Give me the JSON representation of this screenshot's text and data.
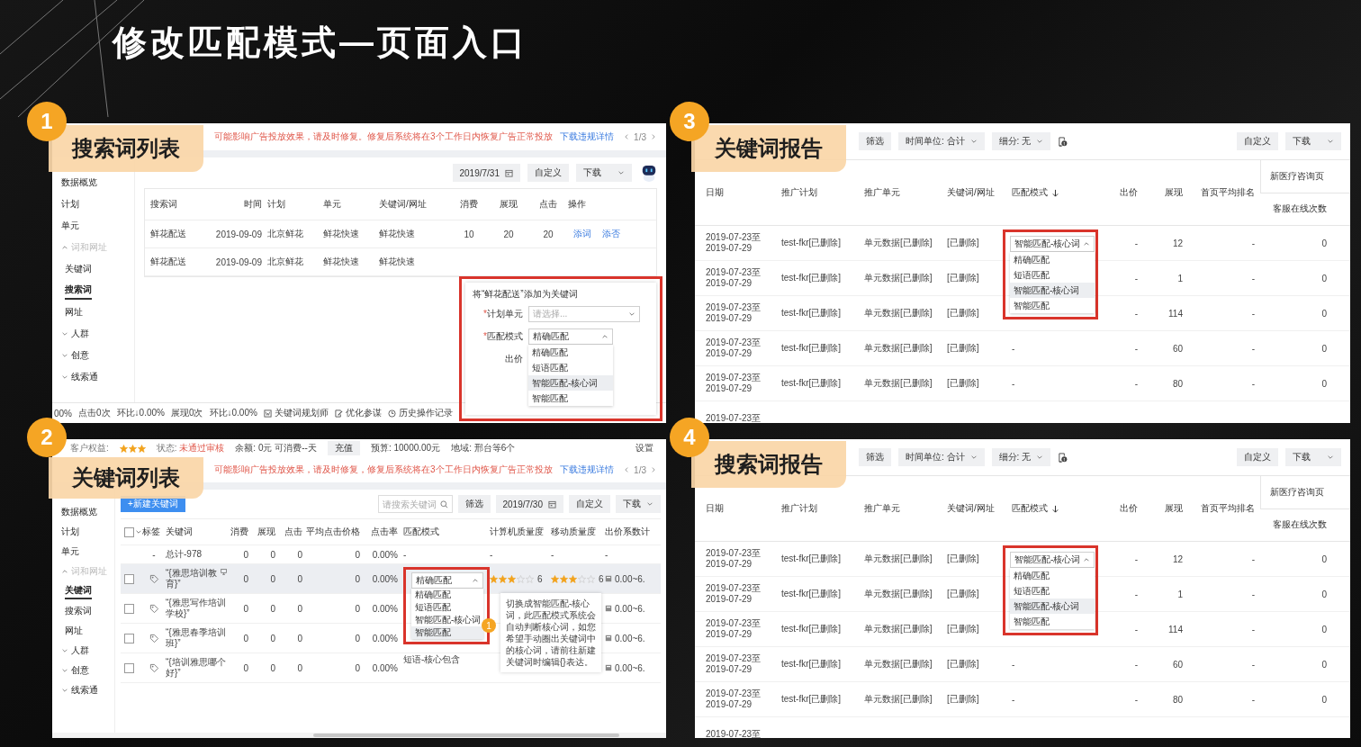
{
  "title": "修改匹配模式—页面入口",
  "panels": [
    {
      "kind": "search_term_list",
      "number": "1",
      "label": "搜索词列表",
      "notice": {
        "text": "可能影响广告投放效果，请及时修复。修复后系统将在3个工作日内恢复广告正常投放",
        "link": "下载违规详情",
        "pager": "1/3"
      },
      "sidebar": [
        {
          "label": "数据概览",
          "selected": false
        },
        {
          "label": "计划",
          "selected": false
        },
        {
          "label": "单元",
          "selected": false
        },
        {
          "label": "词和网址",
          "selected": false,
          "expanded": true,
          "children": [
            {
              "label": "关键词",
              "selected": false
            },
            {
              "label": "搜索词",
              "selected": true
            },
            {
              "label": "网址",
              "selected": false
            }
          ]
        },
        {
          "label": "人群",
          "selected": false,
          "expanded": false
        },
        {
          "label": "创意",
          "selected": false,
          "expanded": false
        },
        {
          "label": "线索通",
          "selected": false,
          "expanded": false
        }
      ],
      "toolbar": {
        "date": "2019/7/31",
        "customize": "自定义",
        "download": "下载"
      },
      "table": {
        "columns": [
          "搜索词",
          "时间",
          "计划",
          "单元",
          "关键词/网址",
          "消费",
          "展现",
          "点击",
          "操作"
        ],
        "rows": [
          {
            "cells": [
              "鲜花配送",
              "2019-09-09",
              "北京鲜花",
              "鲜花快速",
              "鲜花快速",
              "10",
              "20",
              "20"
            ],
            "actions": [
              "添词",
              "添否"
            ]
          },
          {
            "cells": [
              "鲜花配送",
              "2019-09-09",
              "北京鲜花",
              "鲜花快速",
              "鲜花快速"
            ],
            "actions": []
          }
        ]
      },
      "popup": {
        "title": "将“鲜花配送”添加为关键词",
        "fields": [
          {
            "label": "计划单元",
            "required_mark": "*",
            "kind": "select",
            "select": {
              "placeholder": "请选择...",
              "expanded": false
            }
          },
          {
            "label": "匹配模式",
            "required_mark": "*",
            "kind": "select",
            "select": {
              "value": "精确匹配",
              "expanded": true,
              "options": [
                {
                  "label": "精确匹配",
                  "highlighted": false
                },
                {
                  "label": "短语匹配",
                  "highlighted": false
                },
                {
                  "label": "智能匹配-核心词",
                  "highlighted": true
                },
                {
                  "label": "智能匹配",
                  "highlighted": false
                }
              ]
            }
          },
          {
            "label": "出价"
          }
        ]
      },
      "status_bar": {
        "stats": [
          "00%",
          "点击0次",
          "环比↓0.00%",
          "展现0次",
          "环比↓0.00%"
        ],
        "tools": [
          "关键词规划师",
          "优化参谋",
          "历史操作记录"
        ]
      }
    },
    {
      "kind": "keyword_list",
      "number": "2",
      "label": "关键词列表",
      "account_bar": {
        "rating_label": "客户权益:",
        "stars": 3,
        "status_label": "状态:",
        "status": "未通过审核",
        "balance": "余额: 0元 可消费--天",
        "recharge": "充值",
        "budget": "预算: 10000.00元",
        "region": "地域: 邢台等6个",
        "settings": "设置"
      },
      "notice": {
        "text": "可能影响广告投放效果，请及时修复，修复后系统将在3个工作日内恢复广告正常投放",
        "link": "下载违规详情",
        "pager": "1/3"
      },
      "sidebar": [
        {
          "label": "数据概览",
          "selected": false
        },
        {
          "label": "计划",
          "selected": false
        },
        {
          "label": "单元",
          "selected": false
        },
        {
          "label": "词和网址",
          "selected": false,
          "expanded": true,
          "children": [
            {
              "label": "关键词",
              "selected": true
            },
            {
              "label": "搜索词",
              "selected": false
            },
            {
              "label": "网址",
              "selected": false
            }
          ]
        },
        {
          "label": "人群",
          "selected": false,
          "expanded": false
        },
        {
          "label": "创意",
          "selected": false,
          "expanded": false
        },
        {
          "label": "线索通",
          "selected": false,
          "expanded": false
        }
      ],
      "toolbar": {
        "new_button": "+新建关键词",
        "search_placeholder": "请搜索关键词",
        "filter": "筛选",
        "date": "2019/7/30",
        "customize": "自定义",
        "download": "下载"
      },
      "table": {
        "all_checked": false,
        "columns": [
          "标签",
          "关键词",
          "消费",
          "展现",
          "点击",
          "平均点击价格",
          "点击率",
          "匹配模式",
          "计算机质量度",
          "移动质量度",
          "出价系数计"
        ],
        "rows": [
          {
            "kind": "total",
            "tag": "-",
            "keyword": "总计-978",
            "values": [
              "0",
              "0",
              "0",
              "0",
              "0.00%"
            ],
            "match": "-",
            "pc_quality": "-",
            "mobile_quality": "-",
            "bid_factor": "-"
          },
          {
            "kind": "keyword",
            "checked": false,
            "highlighted": true,
            "preview": true,
            "keyword": "“{雅思培训教育}”",
            "values": [
              "0",
              "0",
              "0",
              "0",
              "0.00%"
            ],
            "match_select": {
              "value": "精确匹配",
              "expanded": true,
              "options": [
                {
                  "label": "精确匹配",
                  "highlighted": false
                },
                {
                  "label": "短语匹配",
                  "highlighted": false
                },
                {
                  "label": "智能匹配-核心词",
                  "highlighted": false
                },
                {
                  "label": "智能匹配",
                  "highlighted": true
                }
              ]
            },
            "badge": "1",
            "pc_quality": {
              "stars": 3,
              "score": "6"
            },
            "mobile_quality": {
              "stars": 3,
              "score": "6"
            },
            "bid_factor": "0.00~6.",
            "tooltip": "切换成智能匹配-核心词，此匹配模式系统会自动判断核心词，如您希望手动圈出关键词中的核心词，请前往新建关键词时编辑{}表达。"
          },
          {
            "kind": "keyword",
            "checked": false,
            "highlighted": false,
            "preview": false,
            "keyword": "“{雅思写作培训学校}”",
            "values": [
              "0",
              "0",
              "0",
              "0",
              "0.00%"
            ],
            "bid_factor": "0.00~6."
          },
          {
            "kind": "keyword",
            "checked": false,
            "highlighted": false,
            "preview": false,
            "keyword": "“{雅思春季培训班}”",
            "values": [
              "0",
              "0",
              "0",
              "0",
              "0.00%"
            ],
            "bid_factor": "0.00~6."
          },
          {
            "kind": "keyword",
            "checked": false,
            "highlighted": false,
            "preview": false,
            "keyword": "“{培训雅思哪个好}”",
            "values": [
              "0",
              "0",
              "0",
              "0",
              "0.00%"
            ],
            "match": "短语-核心包含",
            "bid_factor": "0.00~6."
          }
        ]
      }
    },
    {
      "kind": "report",
      "number": "3",
      "label": "关键词报告",
      "toolbar": {
        "filter": "筛选",
        "time_unit": "时间单位: 合计",
        "breakdown": "细分: 无",
        "customize": "自定义",
        "download": "下载"
      },
      "table": {
        "columns": [
          "日期",
          "推广计划",
          "推广单元",
          "关键词/网址",
          "匹配模式",
          "出价",
          "展现",
          "首页平均排名"
        ],
        "group": {
          "label": "新医疗咨询页",
          "columns": [
            "客服在线次数"
          ]
        },
        "match_select": {
          "value": "智能匹配-核心词",
          "expanded": true,
          "options": [
            {
              "label": "精确匹配",
              "highlighted": false
            },
            {
              "label": "短语匹配",
              "highlighted": false
            },
            {
              "label": "智能匹配-核心词",
              "highlighted": true
            },
            {
              "label": "智能匹配",
              "highlighted": false
            }
          ]
        },
        "rows": [
          {
            "date": "2019-07-23至2019-07-29",
            "plan": "test-fkr[已删除]",
            "unit": "单元数据[已删除]",
            "keyword": "[已删除]",
            "bid": "-",
            "impressions": "12",
            "rank": "-",
            "consults": "0"
          },
          {
            "date": "2019-07-23至2019-07-29",
            "plan": "test-fkr[已删除]",
            "unit": "单元数据[已删除]",
            "keyword": "[已删除]",
            "bid": "-",
            "impressions": "1",
            "rank": "-",
            "consults": "0"
          },
          {
            "date": "2019-07-23至2019-07-29",
            "plan": "test-fkr[已删除]",
            "unit": "单元数据[已删除]",
            "keyword": "[已删除]",
            "bid": "-",
            "impressions": "114",
            "rank": "-",
            "consults": "0"
          },
          {
            "date": "2019-07-23至2019-07-29",
            "plan": "test-fkr[已删除]",
            "unit": "单元数据[已删除]",
            "keyword": "[已删除]",
            "match": "-",
            "bid": "-",
            "impressions": "60",
            "rank": "-",
            "consults": "0"
          },
          {
            "date": "2019-07-23至2019-07-29",
            "plan": "test-fkr[已删除]",
            "unit": "单元数据[已删除]",
            "keyword": "[已删除]",
            "match": "-",
            "bid": "-",
            "impressions": "80",
            "rank": "-",
            "consults": "0"
          },
          {
            "date": "2019-07-23至"
          }
        ]
      }
    },
    {
      "kind": "report",
      "number": "4",
      "label": "搜索词报告",
      "toolbar": {
        "filter": "筛选",
        "time_unit": "时间单位: 合计",
        "breakdown": "细分: 无",
        "customize": "自定义",
        "download": "下载"
      },
      "table": {
        "columns": [
          "日期",
          "推广计划",
          "推广单元",
          "关键词/网址",
          "匹配模式",
          "出价",
          "展现",
          "首页平均排名"
        ],
        "group": {
          "label": "新医疗咨询页",
          "columns": [
            "客服在线次数"
          ]
        },
        "match_select": {
          "value": "智能匹配-核心词",
          "expanded": true,
          "options": [
            {
              "label": "精确匹配",
              "highlighted": false
            },
            {
              "label": "短语匹配",
              "highlighted": false
            },
            {
              "label": "智能匹配-核心词",
              "highlighted": true
            },
            {
              "label": "智能匹配",
              "highlighted": false
            }
          ]
        },
        "rows": [
          {
            "date": "2019-07-23至2019-07-29",
            "plan": "test-fkr[已删除]",
            "unit": "单元数据[已删除]",
            "keyword": "[已删除]",
            "bid": "-",
            "impressions": "12",
            "rank": "-",
            "consults": "0"
          },
          {
            "date": "2019-07-23至2019-07-29",
            "plan": "test-fkr[已删除]",
            "unit": "单元数据[已删除]",
            "keyword": "[已删除]",
            "bid": "-",
            "impressions": "1",
            "rank": "-",
            "consults": "0"
          },
          {
            "date": "2019-07-23至2019-07-29",
            "plan": "test-fkr[已删除]",
            "unit": "单元数据[已删除]",
            "keyword": "[已删除]",
            "bid": "-",
            "impressions": "114",
            "rank": "-",
            "consults": "0"
          },
          {
            "date": "2019-07-23至2019-07-29",
            "plan": "test-fkr[已删除]",
            "unit": "单元数据[已删除]",
            "keyword": "[已删除]",
            "match": "-",
            "bid": "-",
            "impressions": "60",
            "rank": "-",
            "consults": "0"
          },
          {
            "date": "2019-07-23至2019-07-29",
            "plan": "test-fkr[已删除]",
            "unit": "单元数据[已删除]",
            "keyword": "[已删除]",
            "match": "-",
            "bid": "-",
            "impressions": "80",
            "rank": "-",
            "consults": "0"
          },
          {
            "date": "2019-07-23至"
          }
        ]
      }
    }
  ]
}
